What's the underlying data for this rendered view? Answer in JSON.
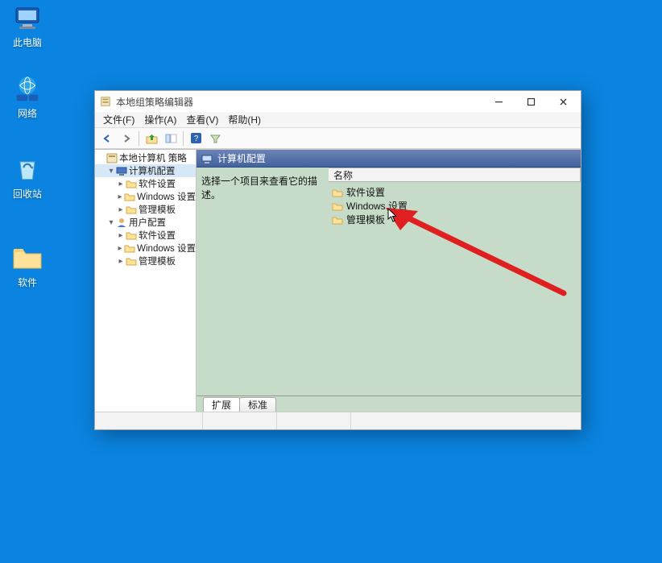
{
  "desktop": {
    "icons": [
      "此电脑",
      "网络",
      "回收站",
      "软件"
    ]
  },
  "window": {
    "title": "本地组策略编辑器",
    "menus": [
      "文件(F)",
      "操作(A)",
      "查看(V)",
      "帮助(H)"
    ],
    "tree": {
      "root": "本地计算机 策略",
      "computer": "计算机配置",
      "computer_children": [
        "软件设置",
        "Windows 设置",
        "管理模板"
      ],
      "user": "用户配置",
      "user_children": [
        "软件设置",
        "Windows 设置",
        "管理模板"
      ]
    },
    "header_title": "计算机配置",
    "desc": "选择一个项目来查看它的描述。",
    "list_header": "名称",
    "list_items": [
      "软件设置",
      "Windows 设置",
      "管理模板"
    ],
    "tabs": [
      "扩展",
      "标准"
    ]
  }
}
